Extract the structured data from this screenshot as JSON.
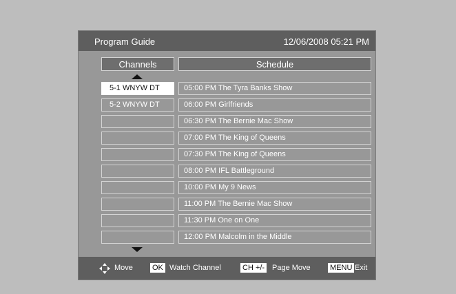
{
  "title": "Program Guide",
  "datetime": "12/06/2008 05:21  PM",
  "headers": {
    "channels": "Channels",
    "schedule": "Schedule"
  },
  "channels": [
    {
      "label": "5-1  WNYW DT",
      "selected": true
    },
    {
      "label": "5-2  WNYW DT",
      "selected": false
    },
    {
      "label": "",
      "selected": false
    },
    {
      "label": "",
      "selected": false
    },
    {
      "label": "",
      "selected": false
    },
    {
      "label": "",
      "selected": false
    },
    {
      "label": "",
      "selected": false
    },
    {
      "label": "",
      "selected": false
    },
    {
      "label": "",
      "selected": false
    },
    {
      "label": "",
      "selected": false
    }
  ],
  "schedule": [
    "05:00 PM  The Tyra Banks Show",
    "06:00 PM  Girlfriends",
    "06:30 PM  The Bernie Mac Show",
    "07:00 PM  The King of Queens",
    "07:30 PM  The King of Queens",
    "08:00 PM  IFL Battleground",
    "10:00 PM  My 9 News",
    "11:00 PM  The Bernie Mac Show",
    "11:30 PM  One on One",
    "12:00 PM  Malcolm in the Middle"
  ],
  "footer": {
    "move": "Move",
    "ok_key": "OK",
    "ok_label": "Watch Channel",
    "ch_key": "CH +/-",
    "ch_label": "Page Move",
    "menu_key": "MENU",
    "menu_label": "Exit"
  }
}
